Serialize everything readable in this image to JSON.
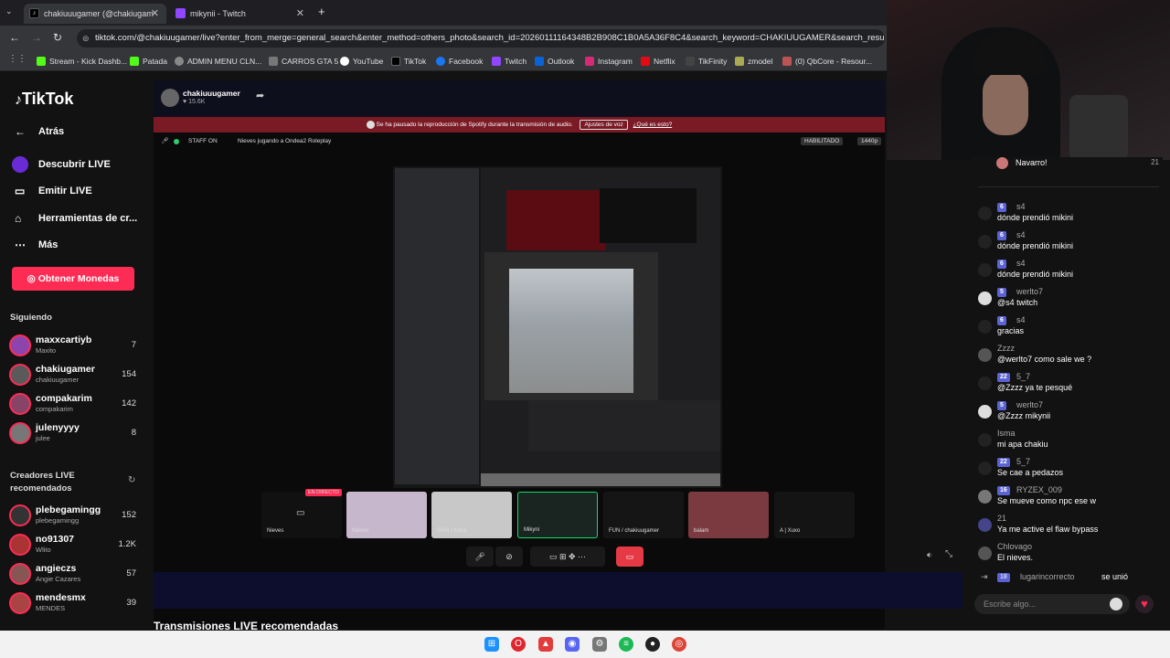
{
  "browser": {
    "tabs": [
      {
        "label": "chakiuuugamer (@chakiugam",
        "active": true
      },
      {
        "label": "mikynii - Twitch",
        "active": false
      }
    ],
    "new_tab": "+",
    "url": "tiktok.com/@chakiuugamer/live?enter_from_merge=general_search&enter_method=others_photo&search_id=20260111164348B2B908C1B0A5A36F8C4&search_keyword=CHAKIUUGAMER&search_result_id=72",
    "bookmarks": [
      "Stream - Kick Dashb...",
      "Patada",
      "ADMIN MENU CLN...",
      "CARROS GTA 5",
      "YouTube",
      "TikTok",
      "Facebook",
      "Twitch",
      "Outlook",
      "Instagram",
      "Netflix",
      "TikFinity",
      "zmodel",
      "(0) QbCore - Resour..."
    ]
  },
  "sidebar": {
    "logo": "TikTok",
    "nav": [
      {
        "label": "Atrás",
        "icon": "back-arrow-icon"
      },
      {
        "label": "Descubrir LIVE",
        "icon": "live-icon"
      },
      {
        "label": "Emitir LIVE",
        "icon": "camera-icon"
      },
      {
        "label": "Herramientas de cr...",
        "icon": "home-icon"
      },
      {
        "label": "Más",
        "icon": "more-icon"
      }
    ],
    "coins_button": "Obtener Monedas",
    "following_title": "Siguiendo",
    "following": [
      {
        "name": "maxxcartiyb",
        "sub": "Maxito",
        "count": "7"
      },
      {
        "name": "chakiugamer",
        "sub": "chakiuugamer",
        "count": "154"
      },
      {
        "name": "compakarim",
        "sub": "compakarim",
        "count": "142"
      },
      {
        "name": "julenyyyy",
        "sub": "julee",
        "count": "8"
      }
    ],
    "recommended_title": "Creadores LIVE recomendados",
    "recommended": [
      {
        "name": "plebegamingg",
        "sub": "plebegamingg",
        "count": "152"
      },
      {
        "name": "no91307",
        "sub": "Wlito",
        "count": "1.2K"
      },
      {
        "name": "angieczs",
        "sub": "Angie Cazares",
        "count": "57"
      },
      {
        "name": "mendesmx",
        "sub": "MENDES",
        "count": "39"
      }
    ]
  },
  "stream": {
    "host_name": "chakiuuugamer",
    "likes": "15.6K",
    "notice": "Se ha pausado la reproducción de Spotify durante la transmisión de audio.",
    "notice_button": "Ajustes de voz",
    "notice_link": "¿Qué es esto?",
    "staff": "STAFF ON",
    "stream_title": "Nieves jugando a Ondea2 Roleplay",
    "habilitado": "HABILITADO",
    "quality": "1440p",
    "live_tag": "EN DIRECTO",
    "thumbs": [
      "Nieves",
      "Nieves",
      "GRN / Keira",
      "Mikyni",
      "FUN / chakiuugamer",
      "balam",
      "A | Xuxo"
    ],
    "recommended_title": "Transmisiones LIVE recomendadas"
  },
  "chat": {
    "top_user": "Navarro!",
    "top_count": "21",
    "messages": [
      {
        "level": "6",
        "user": "s4",
        "text": "dónde prendió mikini"
      },
      {
        "level": "6",
        "user": "s4",
        "text": "dónde prendió mikini"
      },
      {
        "level": "6",
        "user": "s4",
        "text": "dónde prendió mikini"
      },
      {
        "level": "5",
        "user": "werlto7",
        "text": "@s4 twitch"
      },
      {
        "level": "6",
        "user": "s4",
        "text": "gracias"
      },
      {
        "level": "",
        "user": "Zzzz",
        "text": "@werlto7 como sale we ?"
      },
      {
        "level": "22",
        "user": "5_7",
        "text": "@Zzzz ya te pesqué"
      },
      {
        "level": "5",
        "user": "werlto7",
        "text": "@Zzzz mikynii"
      },
      {
        "level": "",
        "user": "Isma",
        "text": "mi apa chakiu"
      },
      {
        "level": "22",
        "user": "5_7",
        "text": "Se cae a pedazos"
      },
      {
        "level": "16",
        "user": "RYZEX_009",
        "text": "Se mueve como npc ese w"
      },
      {
        "level": "",
        "user": "21",
        "text": "Ya me active el flaw bypass"
      },
      {
        "level": "",
        "user": "Chlovago",
        "text": "El nieves."
      }
    ],
    "join": {
      "level": "18",
      "user": "lugarincorrecto",
      "text": "se unió"
    },
    "input_placeholder": "Escribe algo..."
  },
  "colors": {
    "accent": "#fe2c55",
    "badge": "#5b63d3"
  }
}
